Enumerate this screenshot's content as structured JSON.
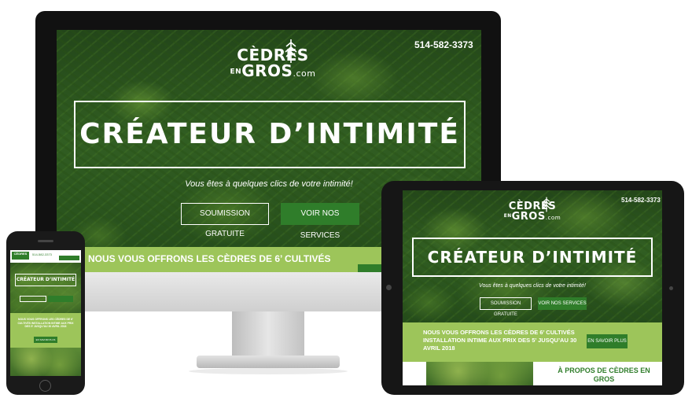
{
  "site": {
    "logo": {
      "line1": "CÈDRES",
      "en": "EN",
      "line2": "GROS",
      "domain": ".com"
    },
    "phone": "514-582-3373",
    "hero_title": "CRÉATEUR D’INTIMITÉ",
    "tagline": "Vous êtes à quelques clics de votre intimité!",
    "btn_quote": "SOUMISSION GRATUITE",
    "btn_services": "VOIR NOS SERVICES",
    "promo_desktop": "NOUS VOUS OFFRONS LES CÈDRES DE 6’ CULTIVÉS",
    "promo_tablet": "NOUS VOUS OFFRONS LES CÈDRES DE 6’ CULTIVÉS INSTALLATION INTIME AUX PRIX DES 5’ JUSQU’AU 30 AVRIL 2018",
    "btn_learn_more": "EN SAVOIR PLUS",
    "about_title": "À PROPOS DE CÈDRES EN GROS",
    "phone_mobile": "514-582-3373",
    "promo_mobile": "NOUS VOUS OFFRONS LES CÈDRES DE 6’ CULTIVÉS INSTALLATION INTIME AUX PRIX DES 5’ JUSQU’AU 30 AVRIL 2018",
    "btn_learn_more_mobile": "EN SAVOIR PLUS"
  },
  "colors": {
    "brand_green": "#2f7d2a",
    "promo_green": "#9dc55a",
    "foliage_dark": "#244b1b"
  }
}
